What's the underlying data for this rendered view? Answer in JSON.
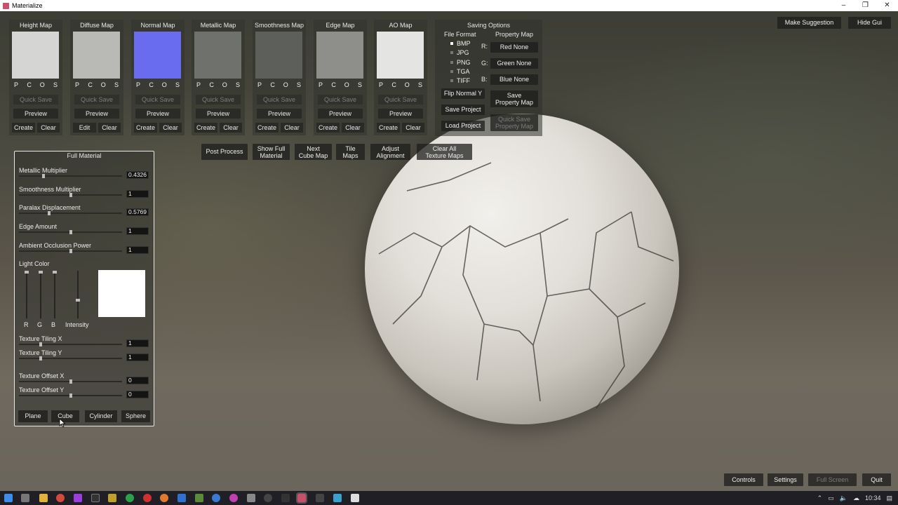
{
  "window": {
    "title": "Materialize",
    "controls": [
      "–",
      "❐",
      "✕"
    ]
  },
  "maps": [
    {
      "title": "Height Map",
      "thumb": "#d5d5d3",
      "pcos": [
        "P",
        "C",
        "O",
        "S"
      ],
      "quick_save": "Quick Save",
      "preview": "Preview",
      "left_btn": "Create",
      "right_btn": "Clear"
    },
    {
      "title": "Diffuse Map",
      "thumb": "#b9b9b6",
      "pcos": [
        "P",
        "C",
        "O",
        "S"
      ],
      "quick_save": "Quick Save",
      "preview": "Preview",
      "left_btn": "Edit",
      "right_btn": "Clear"
    },
    {
      "title": "Normal Map",
      "thumb": "#6a6cf0",
      "pcos": [
        "P",
        "C",
        "O",
        "S"
      ],
      "quick_save": "Quick Save",
      "preview": "Preview",
      "left_btn": "Create",
      "right_btn": "Clear"
    },
    {
      "title": "Metallic Map",
      "thumb": "#6f716c",
      "pcos": [
        "P",
        "C",
        "O",
        "S"
      ],
      "quick_save": "Quick Save",
      "preview": "Preview",
      "left_btn": "Create",
      "right_btn": "Clear"
    },
    {
      "title": "Smoothness Map",
      "thumb": "#5d605a",
      "pcos": [
        "P",
        "C",
        "O",
        "S"
      ],
      "quick_save": "Quick Save",
      "preview": "Preview",
      "left_btn": "Create",
      "right_btn": "Clear"
    },
    {
      "title": "Edge Map",
      "thumb": "#8e8f8b",
      "pcos": [
        "P",
        "C",
        "O",
        "S"
      ],
      "quick_save": "Quick Save",
      "preview": "Preview",
      "left_btn": "Create",
      "right_btn": "Clear"
    },
    {
      "title": "AO Map",
      "thumb": "#e4e4e2",
      "pcos": [
        "P",
        "C",
        "O",
        "S"
      ],
      "quick_save": "Quick Save",
      "preview": "Preview",
      "left_btn": "Create",
      "right_btn": "Clear"
    }
  ],
  "saving": {
    "title": "Saving Options",
    "file_format_label": "File Format",
    "property_map_label": "Property Map",
    "formats": [
      "BMP",
      "JPG",
      "PNG",
      "TGA",
      "TIFF"
    ],
    "selected_format": "BMP",
    "channels": [
      {
        "letter": "R:",
        "label": "Red None"
      },
      {
        "letter": "G:",
        "label": "Green None"
      },
      {
        "letter": "B:",
        "label": "Blue None"
      }
    ],
    "flip_normal": "Flip Normal Y",
    "save_property_1": "Save",
    "save_property_2": "Property Map",
    "save_project": "Save Project",
    "load_project": "Load Project",
    "quick_save_property_1": "Quick Save",
    "quick_save_property_2": "Property Map"
  },
  "toolbar": {
    "post_process": "Post Process",
    "show_full_1": "Show Full",
    "show_full_2": "Material",
    "next_cube_1": "Next",
    "next_cube_2": "Cube Map",
    "tile_1": "Tile",
    "tile_2": "Maps",
    "adjust_1": "Adjust",
    "adjust_2": "Alignment",
    "clear_all_1": "Clear All",
    "clear_all_2": "Texture Maps"
  },
  "top_right": {
    "suggestion": "Make Suggestion",
    "hide_gui": "Hide Gui"
  },
  "full_material": {
    "title": "Full Material",
    "sliders": [
      {
        "label": "Metallic Multiplier",
        "value": "0.4326",
        "level": 0.23
      },
      {
        "label": "Smoothness Multiplier",
        "value": "1",
        "level": 0.5
      },
      {
        "label": "Paralax Displacement",
        "value": "0.5769",
        "level": 0.29
      },
      {
        "label": "Edge Amount",
        "value": "1",
        "level": 0.5
      },
      {
        "label": "Ambient Occlusion Power",
        "value": "1",
        "level": 0.5
      }
    ],
    "light_color_label": "Light Color",
    "light_channels": [
      "R",
      "G",
      "B",
      "Intensity"
    ],
    "light_color": "#ffffff",
    "tiling": [
      {
        "label": "Texture Tiling X",
        "value": "1",
        "level": 0.2
      },
      {
        "label": "Texture Tiling Y",
        "value": "1",
        "level": 0.2
      }
    ],
    "offset": [
      {
        "label": "Texture Offset X",
        "value": "0",
        "level": 0.5
      },
      {
        "label": "Texture Offset Y",
        "value": "0",
        "level": 0.5
      }
    ],
    "shapes": [
      "Plane",
      "Cube",
      "Cylinder",
      "Sphere"
    ]
  },
  "bottom": {
    "controls": "Controls",
    "settings": "Settings",
    "full_screen": "Full Screen",
    "quit": "Quit"
  },
  "taskbar": {
    "time": "10:34"
  }
}
